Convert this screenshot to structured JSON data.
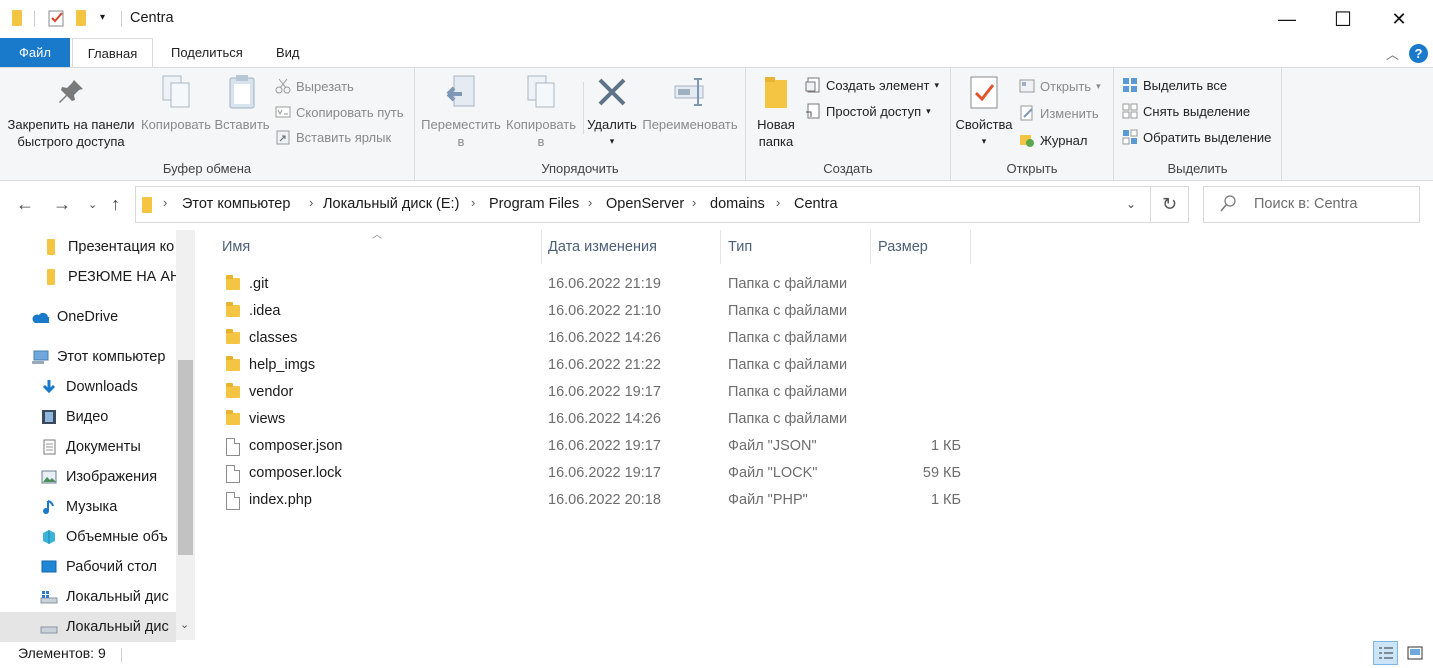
{
  "window": {
    "title": "Centra",
    "minimize_glyph": "—",
    "maximize_glyph": "☐",
    "close_glyph": "✕"
  },
  "ribbon_tabs": [
    "Файл",
    "Главная",
    "Поделиться",
    "Вид"
  ],
  "ribbon": {
    "clipboard": {
      "pin_label_1": "Закрепить на панели",
      "pin_label_2": "быстрого доступа",
      "copy_label": "Копировать",
      "paste_label": "Вставить",
      "cut_label": "Вырезать",
      "copy_path_label": "Скопировать путь",
      "paste_shortcut_label": "Вставить ярлык",
      "group_label": "Буфер обмена"
    },
    "organize": {
      "move_label_1": "Переместить",
      "move_label_2": "в",
      "copyto_label_1": "Копировать",
      "copyto_label_2": "в",
      "delete_label": "Удалить",
      "rename_label": "Переименовать",
      "group_label": "Упорядочить"
    },
    "new": {
      "new_folder_label_1": "Новая",
      "new_folder_label_2": "папка",
      "new_item_label": "Создать элемент",
      "easy_access_label": "Простой доступ",
      "group_label": "Создать"
    },
    "open": {
      "properties_label": "Свойства",
      "open_label": "Открыть",
      "edit_label": "Изменить",
      "history_label": "Журнал",
      "group_label": "Открыть"
    },
    "select": {
      "select_all_label": "Выделить все",
      "select_none_label": "Снять выделение",
      "invert_label": "Обратить выделение",
      "group_label": "Выделить"
    }
  },
  "address": {
    "crumbs": [
      "Этот компьютер",
      "Локальный диск (E:)",
      "Program Files",
      "OpenServer",
      "domains",
      "Centra"
    ],
    "search_placeholder": "Поиск в: Centra"
  },
  "nav_pane": {
    "items": [
      {
        "label": "Презентация ко",
        "icon": "folder-icon"
      },
      {
        "label": "РЕЗЮМЕ НА АН",
        "icon": "folder-icon"
      },
      {
        "label": "OneDrive",
        "icon": "cloud-icon"
      },
      {
        "label": "Этот компьютер",
        "icon": "computer-icon"
      },
      {
        "label": "Downloads",
        "icon": "download-icon"
      },
      {
        "label": "Видео",
        "icon": "video-icon"
      },
      {
        "label": "Документы",
        "icon": "documents-icon"
      },
      {
        "label": "Изображения",
        "icon": "pictures-icon"
      },
      {
        "label": "Музыка",
        "icon": "music-icon"
      },
      {
        "label": "Объемные объ",
        "icon": "3d-objects-icon"
      },
      {
        "label": "Рабочий стол",
        "icon": "desktop-icon"
      },
      {
        "label": "Локальный дис",
        "icon": "drive-icon"
      },
      {
        "label": "Локальный дис",
        "icon": "drive-icon"
      }
    ]
  },
  "columns": [
    "Имя",
    "Дата изменения",
    "Тип",
    "Размер"
  ],
  "files": [
    {
      "name": ".git",
      "date": "16.06.2022 21:19",
      "type": "Папка с файлами",
      "size": "",
      "kind": "folder"
    },
    {
      "name": ".idea",
      "date": "16.06.2022 21:10",
      "type": "Папка с файлами",
      "size": "",
      "kind": "folder"
    },
    {
      "name": "classes",
      "date": "16.06.2022 14:26",
      "type": "Папка с файлами",
      "size": "",
      "kind": "folder"
    },
    {
      "name": "help_imgs",
      "date": "16.06.2022 21:22",
      "type": "Папка с файлами",
      "size": "",
      "kind": "folder"
    },
    {
      "name": "vendor",
      "date": "16.06.2022 19:17",
      "type": "Папка с файлами",
      "size": "",
      "kind": "folder"
    },
    {
      "name": "views",
      "date": "16.06.2022 14:26",
      "type": "Папка с файлами",
      "size": "",
      "kind": "folder"
    },
    {
      "name": "composer.json",
      "date": "16.06.2022 19:17",
      "type": "Файл \"JSON\"",
      "size": "1 КБ",
      "kind": "file"
    },
    {
      "name": "composer.lock",
      "date": "16.06.2022 19:17",
      "type": "Файл \"LOCK\"",
      "size": "59 КБ",
      "kind": "file"
    },
    {
      "name": "index.php",
      "date": "16.06.2022 20:18",
      "type": "Файл \"PHP\"",
      "size": "1 КБ",
      "kind": "file"
    }
  ],
  "status": {
    "items_count": "Элементов: 9"
  },
  "colors": {
    "file_tab": "#1979ca",
    "folder": "#f4c542",
    "help_button": "#1979ca"
  }
}
